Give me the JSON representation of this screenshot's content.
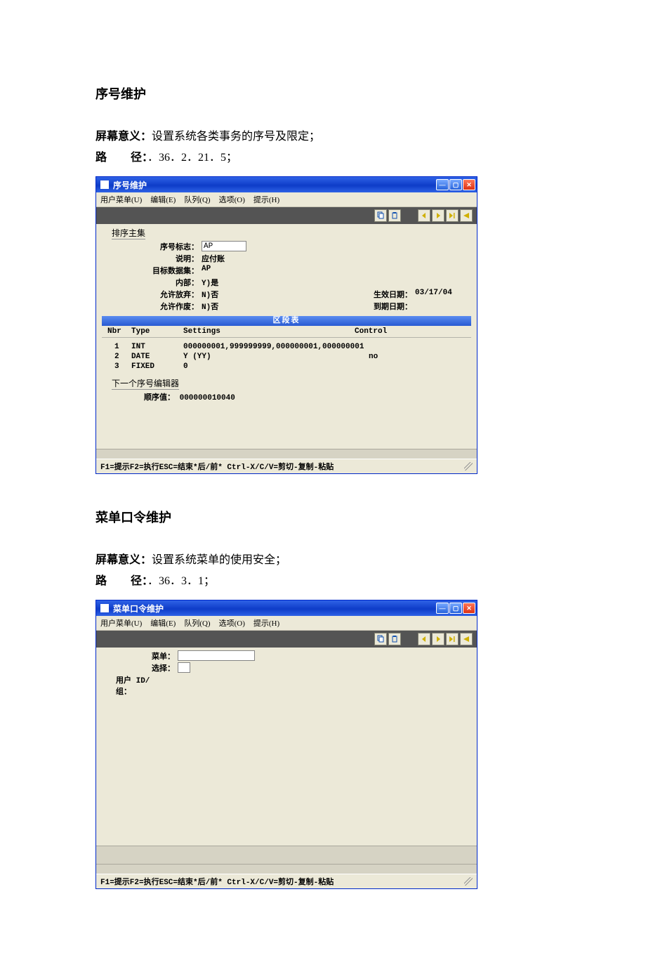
{
  "section1": {
    "heading": "序号维护",
    "meaning_label": "屏幕意义：",
    "meaning_text": "设置系统各类事务的序号及限定；",
    "path_label": "路",
    "path_label2": "径：",
    "path_text": "．36．2．21．5；"
  },
  "win1": {
    "title": "序号维护",
    "menu": [
      "用户菜单(U)",
      "编辑(E)",
      "队列(Q)",
      "选项(O)",
      "提示(H)"
    ],
    "group_label": "排序主集",
    "fields": {
      "f1_label": "序号标志：",
      "f1_value": "AP",
      "f2_label": "说明：",
      "f2_value": "应付账",
      "f3_label": "目标数据集：",
      "f3_value": "AP",
      "f4_label": "内部：",
      "f4_value": "Y)是",
      "f5_label": "允许放弃：",
      "f5_value": "N)否",
      "f6_label": "允许作废：",
      "f6_value": "N)否",
      "r1_label": "生效日期：",
      "r1_value": "03/17/04",
      "r2_label": "到期日期："
    },
    "segment_title": "区段表",
    "seg_header": {
      "c1": "Nbr",
      "c2": "Type",
      "c3": "Settings",
      "c4": "Control"
    },
    "seg_rows": [
      {
        "c1": "1",
        "c2": "INT",
        "c3": "000000001,999999999,000000001,000000001",
        "c4": ""
      },
      {
        "c1": "2",
        "c2": "DATE",
        "c3": "Y (YY)",
        "c4": "no"
      },
      {
        "c1": "3",
        "c2": "FIXED",
        "c3": "0",
        "c4": ""
      }
    ],
    "editor_group": "下一个序号编辑器",
    "editor_row_label": "顺序值：",
    "editor_row_value": "000000010040",
    "status": "F1=提示F2=执行ESC=结束*后/前* Ctrl-X/C/V=剪切-复制-粘贴"
  },
  "section2": {
    "heading": "菜单口令维护",
    "meaning_label": "屏幕意义：",
    "meaning_text": "设置系统菜单的使用安全；",
    "path_label": "路",
    "path_label2": "径：",
    "path_text": "．36．3．1；"
  },
  "win2": {
    "title": "菜单口令维护",
    "menu": [
      "用户菜单(U)",
      "编辑(E)",
      "队列(Q)",
      "选项(O)",
      "提示(H)"
    ],
    "fields": {
      "f1_label": "菜单：",
      "f2_label": "选择：",
      "f3_label": "用户 ID/组："
    },
    "status": "F1=提示F2=执行ESC=结束*后/前* Ctrl-X/C/V=剪切-复制-粘贴"
  }
}
